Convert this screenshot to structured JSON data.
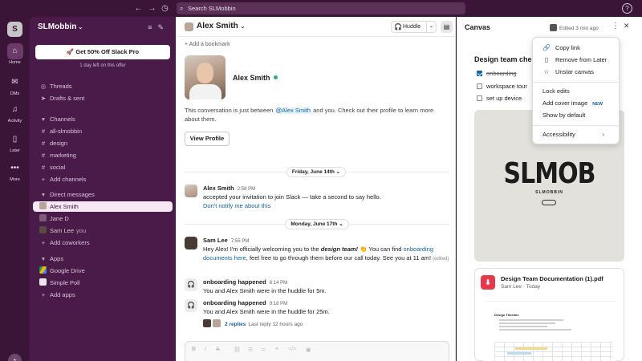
{
  "topbar": {
    "search_placeholder": "Search SLMobbin",
    "back_icon": "arrow-left-icon",
    "forward_icon": "arrow-right-icon",
    "history_icon": "clock-icon",
    "help_icon": "help-icon"
  },
  "rail": {
    "workspace_initial": "S",
    "items": [
      {
        "label": "Home",
        "icon": "home-icon"
      },
      {
        "label": "DMs",
        "icon": "dm-icon"
      },
      {
        "label": "Activity",
        "icon": "bell-icon"
      },
      {
        "label": "Later",
        "icon": "bookmark-icon"
      },
      {
        "label": "More",
        "icon": "more-icon"
      }
    ]
  },
  "sidebar": {
    "workspace_name": "SLMobbin",
    "promo_button": "Get 50% Off Slack Pro",
    "promo_sub": "1 day left on this offer",
    "threads": "Threads",
    "drafts": "Drafts & sent",
    "channels_header": "Channels",
    "channels": [
      "all-slmobbin",
      "design",
      "marketing",
      "social"
    ],
    "add_channels": "Add channels",
    "dm_header": "Direct messages",
    "dms": [
      {
        "name": "Alex Smith",
        "suffix": ""
      },
      {
        "name": "Jane D",
        "suffix": ""
      },
      {
        "name": "Sam Lee",
        "suffix": "you"
      }
    ],
    "add_coworkers": "Add coworkers",
    "apps_header": "Apps",
    "apps": [
      "Google Drive",
      "Simple Poll"
    ],
    "add_apps": "Add apps"
  },
  "main": {
    "title": "Alex Smith",
    "huddle_label": "Huddle",
    "add_bookmark": "Add a bookmark",
    "profile_name": "Alex Smith",
    "intro_before": "This conversation is just between ",
    "intro_mention": "@Alex Smith",
    "intro_after": " and you. Check out their profile to learn more about them.",
    "view_profile": "View Profile",
    "date1": "Friday, June 14th",
    "date2": "Monday, June 17th",
    "messages": [
      {
        "author": "Alex Smith",
        "time": "2:58 PM",
        "text": "accepted your invitation to join Slack — take a second to say hello.",
        "link": "Don't notify me about this"
      },
      {
        "author": "Sam Lee",
        "time": "7:55 PM",
        "text_a": "Hey Alex! I'm officially welcoming you to the ",
        "text_b": "design team!",
        "text_c": " 👏 You can find ",
        "link": "onboarding documents here",
        "text_d": ", feel free to go through them before our call today. See you at 11 am! ",
        "edited": "(edited)"
      },
      {
        "author": "onboarding happened",
        "time": "8:14 PM",
        "text": "You and Alex Smith were in the huddle for 5m."
      },
      {
        "author": "onboarding happened",
        "time": "9:18 PM",
        "text": "You and Alex Smith were in the huddle for 25m.",
        "replies": "2 replies",
        "last_reply": "Last reply 12 hours ago"
      }
    ]
  },
  "canvas": {
    "title": "Canvas",
    "edited": "Edited 3 min ago",
    "heading": "Design team che",
    "todos": [
      {
        "text": "onboarding",
        "checked": true
      },
      {
        "text": "workspace tour",
        "checked": false
      },
      {
        "text": "set up device",
        "checked": false
      }
    ],
    "logo_text": "SLMOB",
    "logo_sub": "SLMOBBIN",
    "pdf_name": "Design Team Documentation (1).pdf",
    "pdf_author": "Sam Lee",
    "pdf_date": "Today",
    "pdf_preview_title": "Design Timeline"
  },
  "menu": {
    "items": [
      {
        "label": "Copy link",
        "icon": "link-icon"
      },
      {
        "label": "Remove from Later",
        "icon": "bookmark-icon"
      },
      {
        "label": "Unstar canvas",
        "icon": "star-icon"
      },
      {
        "label": "Lock edits"
      },
      {
        "label": "Add cover image",
        "badge": "NEW"
      },
      {
        "label": "Show by default"
      },
      {
        "label": "Accessibility"
      }
    ]
  },
  "colors": {
    "aubergine": "#3f0e40",
    "sidebar": "#4a1a49",
    "link": "#1264a3",
    "online": "#2bac76"
  }
}
